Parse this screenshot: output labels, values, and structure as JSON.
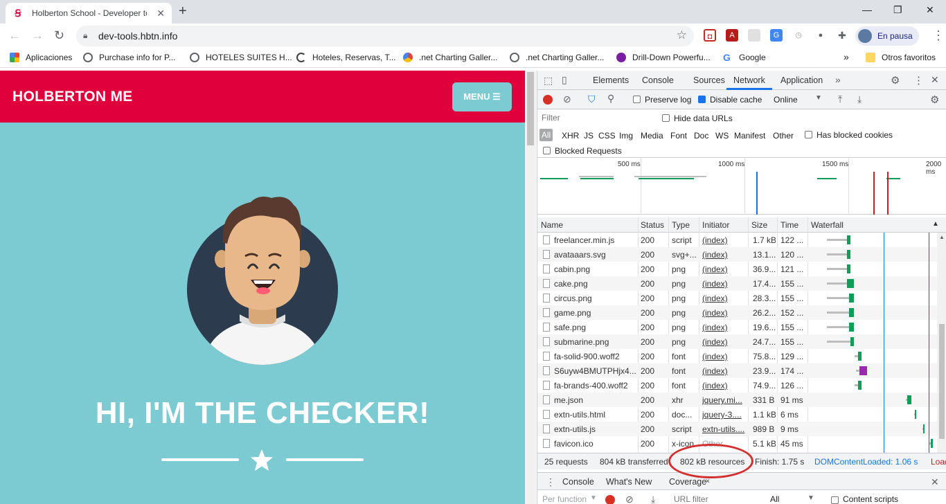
{
  "browser": {
    "tab_title": "Holberton School - Developer tools",
    "url": "dev-tools.hbtn.info",
    "profile_label": "En pausa",
    "bookmarks": [
      {
        "label": "Aplicaciones",
        "color": "#ea4335"
      },
      {
        "label": "Purchase info for P...",
        "color": "#5f6368"
      },
      {
        "label": "HOTELES SUITES H...",
        "color": "#5f6368"
      },
      {
        "label": "Hoteles, Reservas, T...",
        "color": "#3c4043"
      },
      {
        "label": ".net Charting Galler...",
        "color": "#fbbc05"
      },
      {
        "label": ".net Charting Galler...",
        "color": "#5f6368"
      },
      {
        "label": "Drill-Down Powerfu...",
        "color": "#7b1fa2"
      },
      {
        "label": "Google",
        "color": "#4285f4"
      }
    ],
    "more_bookmarks": "»",
    "other_bookmarks": "Otros favoritos"
  },
  "page": {
    "brand": "HOLBERTON ME",
    "menu_label": "MENU ☰",
    "hero_title": "HI, I'M THE CHECKER!",
    "colors": {
      "header": "#e0003c",
      "background": "#7ccbd3"
    }
  },
  "devtools": {
    "tabs": [
      "Elements",
      "Console",
      "Sources",
      "Network",
      "Application"
    ],
    "active_tab": "Network",
    "toolbar": {
      "preserve_log": "Preserve log",
      "disable_cache": "Disable cache",
      "throttle": "Online"
    },
    "filter_placeholder": "Filter",
    "hide_data_urls": "Hide data URLs",
    "filter_types": [
      "All",
      "XHR",
      "JS",
      "CSS",
      "Img",
      "Media",
      "Font",
      "Doc",
      "WS",
      "Manifest",
      "Other"
    ],
    "has_blocked_cookies": "Has blocked cookies",
    "blocked_requests": "Blocked Requests",
    "overview_ticks": [
      "500 ms",
      "1000 ms",
      "1500 ms",
      "2000 ms"
    ],
    "columns": [
      "Name",
      "Status",
      "Type",
      "Initiator",
      "Size",
      "Time",
      "Waterfall"
    ],
    "requests": [
      {
        "name": "freelancer.min.js",
        "status": "200",
        "type": "script",
        "initiator": "(index)",
        "size": "1.7 kB",
        "time": "122 ..."
      },
      {
        "name": "avataaars.svg",
        "status": "200",
        "type": "svg+...",
        "initiator": "(index)",
        "size": "13.1...",
        "time": "120 ..."
      },
      {
        "name": "cabin.png",
        "status": "200",
        "type": "png",
        "initiator": "(index)",
        "size": "36.9...",
        "time": "121 ..."
      },
      {
        "name": "cake.png",
        "status": "200",
        "type": "png",
        "initiator": "(index)",
        "size": "17.4...",
        "time": "155 ..."
      },
      {
        "name": "circus.png",
        "status": "200",
        "type": "png",
        "initiator": "(index)",
        "size": "28.3...",
        "time": "155 ..."
      },
      {
        "name": "game.png",
        "status": "200",
        "type": "png",
        "initiator": "(index)",
        "size": "26.2...",
        "time": "152 ..."
      },
      {
        "name": "safe.png",
        "status": "200",
        "type": "png",
        "initiator": "(index)",
        "size": "19.6...",
        "time": "155 ..."
      },
      {
        "name": "submarine.png",
        "status": "200",
        "type": "png",
        "initiator": "(index)",
        "size": "24.7...",
        "time": "155 ..."
      },
      {
        "name": "fa-solid-900.woff2",
        "status": "200",
        "type": "font",
        "initiator": "(index)",
        "size": "75.8...",
        "time": "129 ..."
      },
      {
        "name": "S6uyw4BMUTPHjx4...",
        "status": "200",
        "type": "font",
        "initiator": "(index)",
        "size": "23.9...",
        "time": "174 ..."
      },
      {
        "name": "fa-brands-400.woff2",
        "status": "200",
        "type": "font",
        "initiator": "(index)",
        "size": "74.9...",
        "time": "126 ..."
      },
      {
        "name": "me.json",
        "status": "200",
        "type": "xhr",
        "initiator": "jquery.mi...",
        "size": "331 B",
        "time": "91 ms"
      },
      {
        "name": "extn-utils.html",
        "status": "200",
        "type": "doc...",
        "initiator": "jquery-3....",
        "size": "1.1 kB",
        "time": "6 ms"
      },
      {
        "name": "extn-utils.js",
        "status": "200",
        "type": "script",
        "initiator": "extn-utils....",
        "size": "989 B",
        "time": "9 ms"
      },
      {
        "name": "favicon.ico",
        "status": "200",
        "type": "x-icon",
        "initiator": "Other",
        "size": "5.1 kB",
        "time": "45 ms"
      }
    ],
    "summary": {
      "requests": "25 requests",
      "transferred": "804 kB transferred",
      "resources": "802 kB resources",
      "finish": "Finish: 1.75 s",
      "dom_loaded": "DOMContentLoaded: 1.06 s",
      "load": "Load"
    },
    "drawer_tabs": [
      "Console",
      "What's New",
      "Coverage"
    ],
    "coverage": {
      "per_function": "Per function",
      "url_filter": "URL filter",
      "all": "All",
      "content_scripts": "Content scripts"
    }
  }
}
